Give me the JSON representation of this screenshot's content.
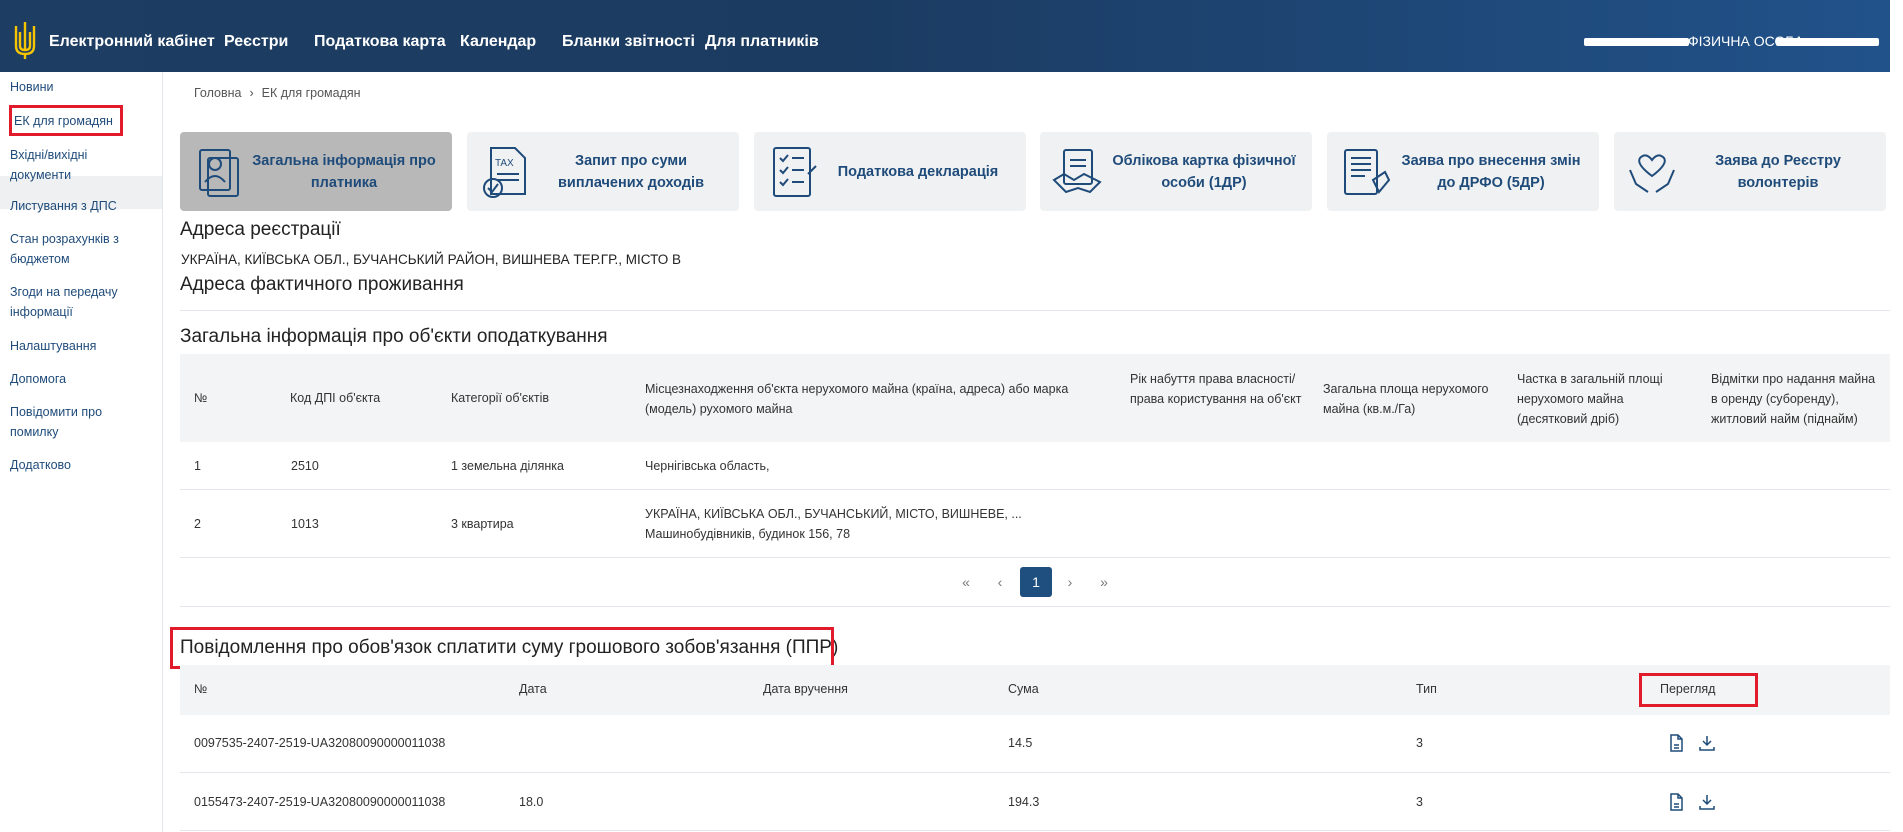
{
  "header": {
    "brand": "Електронний кабінет",
    "nav": [
      "Реєстри",
      "Податкова карта",
      "Календар",
      "Бланки звітності",
      "Для платників"
    ],
    "user_label": "ФІЗИЧНА ОСОБА"
  },
  "sidebar": {
    "items": [
      "Новини",
      "ЕК для громадян",
      "Вхідні/вихідні документи",
      "Листування з ДПС",
      "Стан розрахунків з бюджетом",
      "Згоди на передачу інформації",
      "Налаштування",
      "Допомога",
      "Повідомити про помилку",
      "Додатково"
    ]
  },
  "breadcrumb": {
    "home": "Головна",
    "current": "ЕК для громадян"
  },
  "cards": [
    {
      "label": "Загальна інформація про платника",
      "icon": "person-card-icon"
    },
    {
      "label": "Запит про суми виплачених доходів",
      "icon": "tax-document-icon"
    },
    {
      "label": "Податкова декларація",
      "icon": "checklist-icon"
    },
    {
      "label": "Облікова картка фізичної особи (1ДР)",
      "icon": "handshake-document-icon"
    },
    {
      "label": "Заява про внесення змін до ДРФО (5ДР)",
      "icon": "form-hand-icon"
    },
    {
      "label": "Заява до Реєстру волонтерів",
      "icon": "volunteer-hands-icon"
    }
  ],
  "registration": {
    "title": "Адреса реєстрації",
    "address": "УКРАЇНА, КИЇВСЬКА ОБЛ., БУЧАНСЬКИЙ РАЙОН, ВИШНЕВА ТЕР.ГР., МІСТО В"
  },
  "actual_address": {
    "title": "Адреса фактичного проживання"
  },
  "objects": {
    "title": "Загальна інформація про об'єкти оподаткування",
    "columns": [
      "№",
      "Код ДПІ об'єкта",
      "Категорії об'єктів",
      "Місцезнаходження об'єкта нерухомого майна (країна, адреса) або марка (модель) рухомого майна",
      "Рік набуття права власності/ права користування на об'єкт",
      "Загальна площа нерухомого майна (кв.м./Га)",
      "Частка в загальній площі нерухомого майна (десятковий дріб)",
      "Відмітки про надання майна в оренду (суборенду), житловий найм (піднайм)"
    ],
    "rows": [
      {
        "n": "1",
        "code": "2510",
        "category": "1 земельна ділянка",
        "location": "Чернігівська область, ",
        "location2": ""
      },
      {
        "n": "2",
        "code": "1013",
        "category": "3 квартира",
        "location": "УКРАЇНА, КИЇВСЬКА ОБЛ., БУЧАНСЬКИЙ, МІСТО, ВИШНЕВЕ, ...",
        "location2": "Машинобудівників, будинок 156, 78"
      }
    ]
  },
  "pagination": {
    "first": "«",
    "prev": "‹",
    "current": "1",
    "next": "›",
    "last": "»"
  },
  "ppr": {
    "title": "Повідомлення про обов'язок сплатити суму грошового зобов'язання (ППР)",
    "columns": [
      "№",
      "Дата",
      "Дата вручення",
      "Сума",
      "Тип",
      "Перегляд"
    ],
    "rows": [
      {
        "n": "0097535-2407-2519-UA32080090000011038",
        "sum": "14.5",
        "type": "3"
      },
      {
        "n": "0155473-2407-2519-UA32080090000011038",
        "date": "18.0",
        "sum": "194.3",
        "type": "3"
      }
    ]
  },
  "colors": {
    "header": "#1d3d63",
    "link": "#1f4b7a",
    "highlight": "#e21b2c",
    "page_active": "#1e4f7f"
  }
}
